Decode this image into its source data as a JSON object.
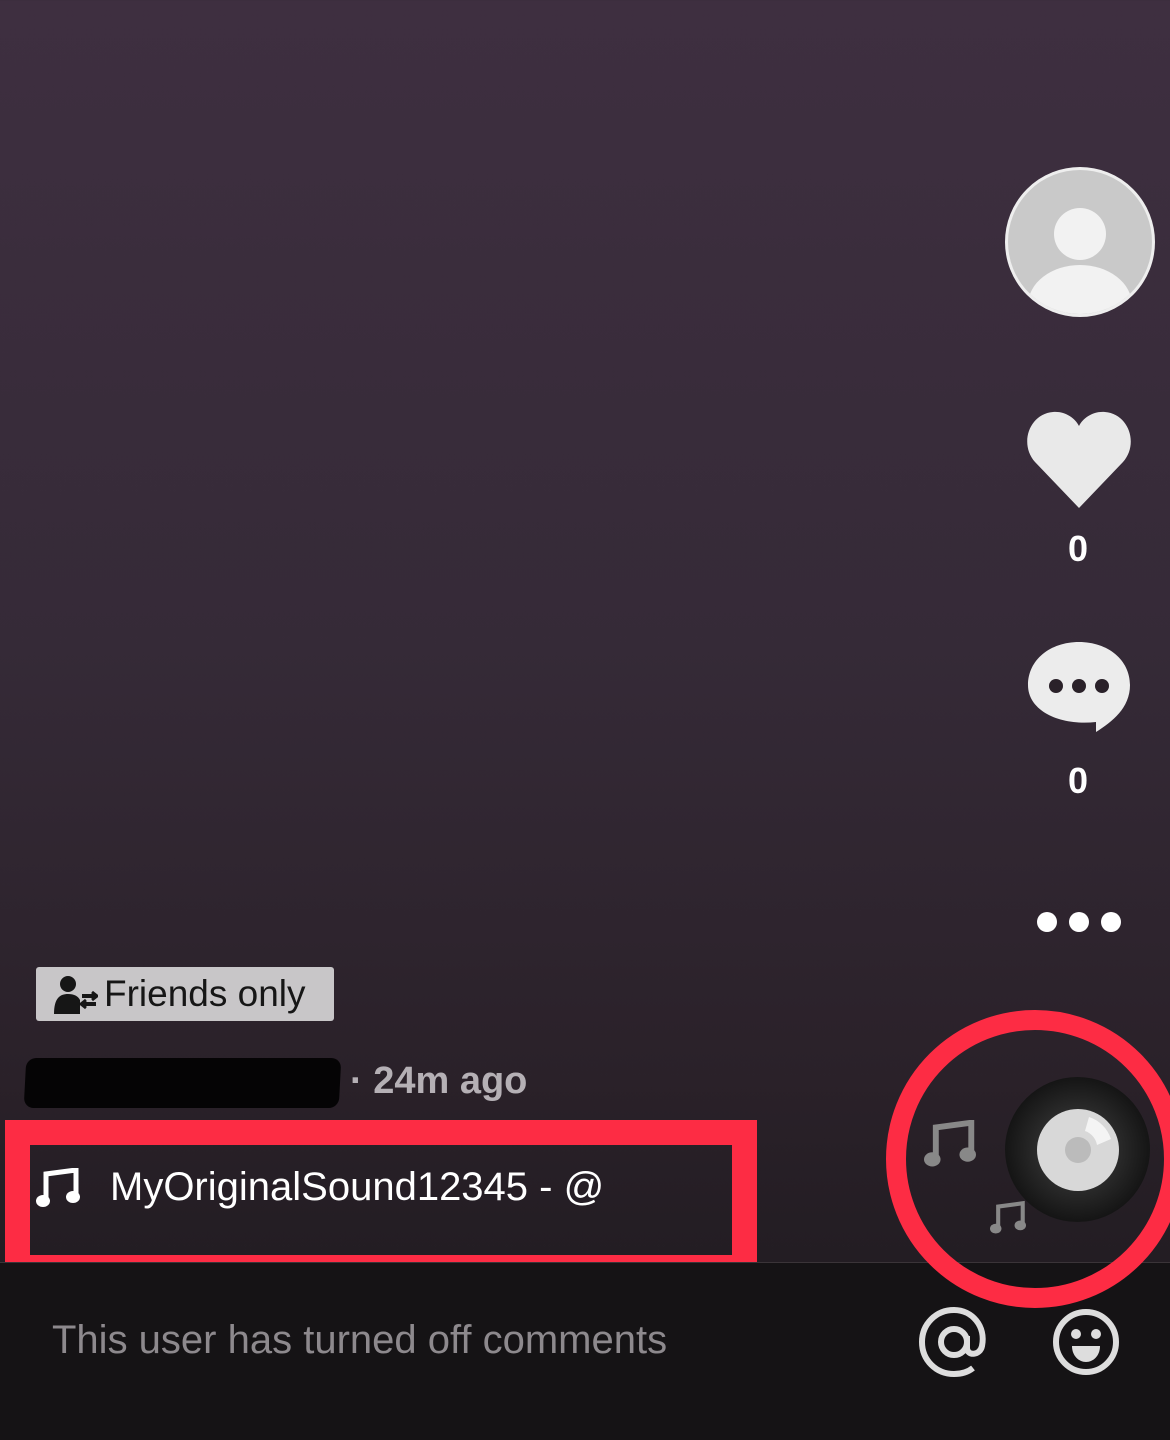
{
  "side_actions": {
    "like_count": "0",
    "comment_count": "0"
  },
  "post": {
    "privacy_badge": "Friends only",
    "time_ago": "· 24m ago",
    "sound_label": "MyOriginalSound12345 - @"
  },
  "comment_bar": {
    "disabled_text": "This user has turned off comments"
  },
  "colors": {
    "annotation": "#fd2c44",
    "bottom_bar": "#151315"
  }
}
